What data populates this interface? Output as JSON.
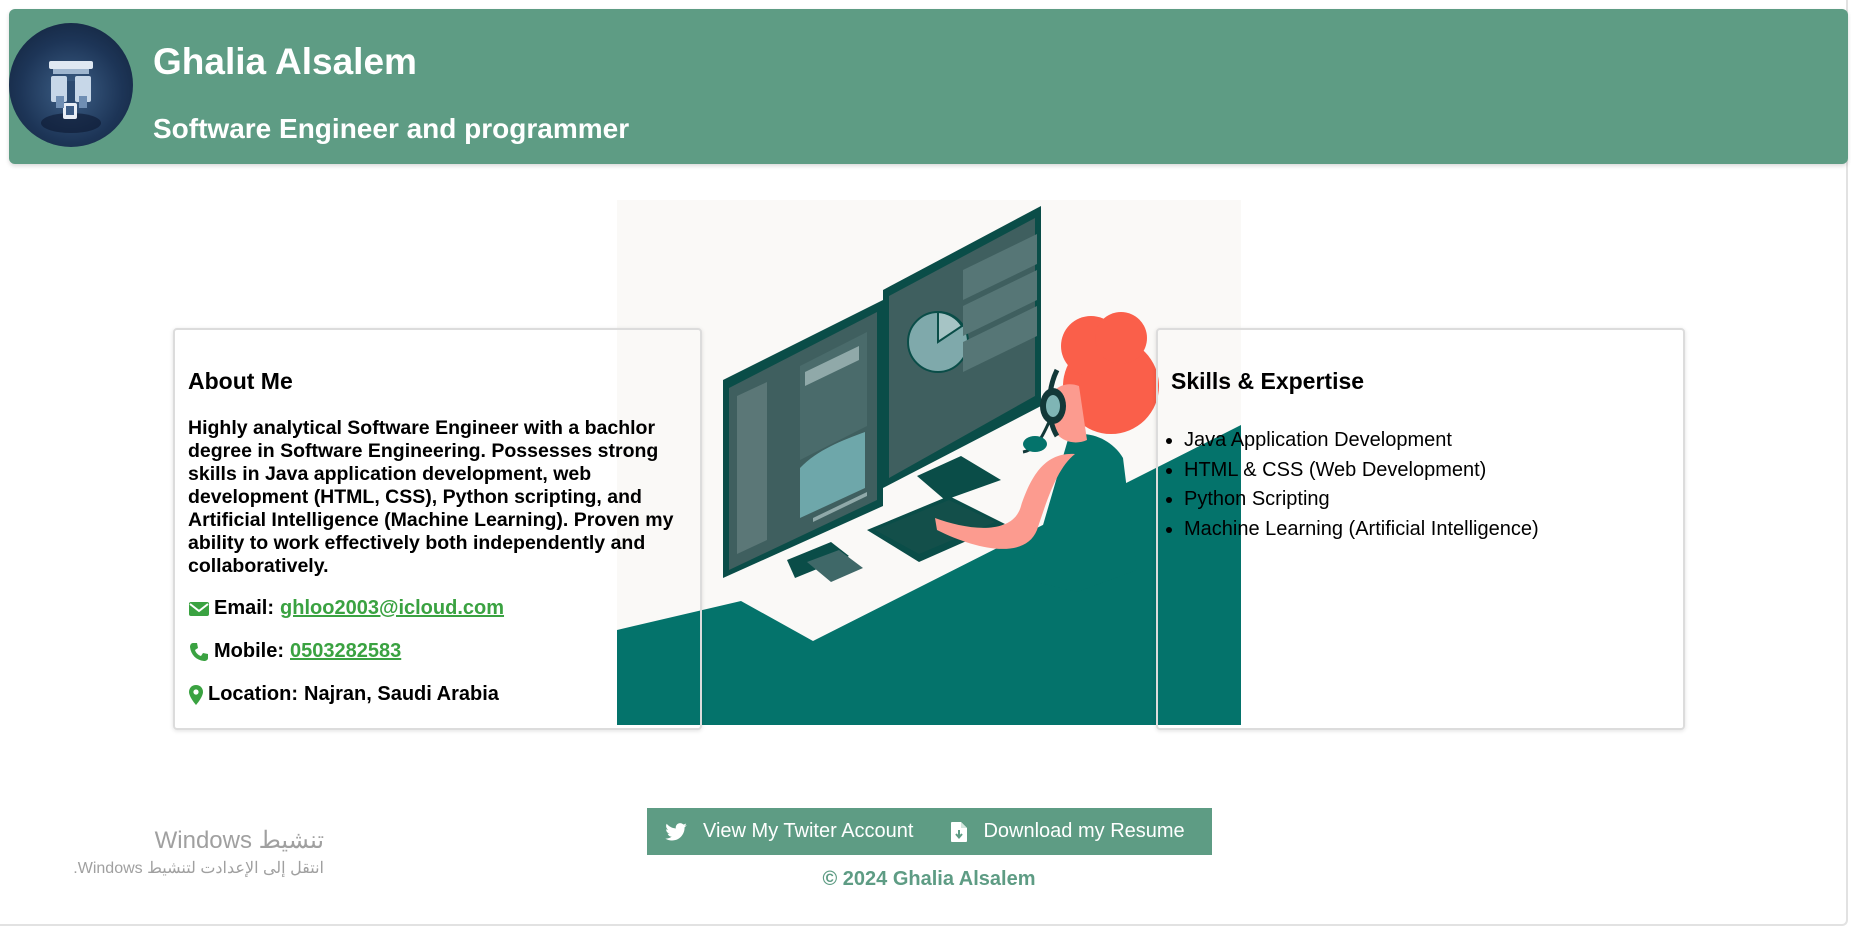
{
  "header": {
    "name": "Ghalia Alsalem",
    "subtitle": "Software Engineer and programmer"
  },
  "about": {
    "heading": "About Me",
    "description": "Highly analytical Software Engineer with a bachlor degree in Software Engineering. Possesses strong skills in Java application development, web development (HTML, CSS), Python scripting, and Artificial Intelligence (Machine Learning). Proven my ability to work effectively both independently and collaboratively.",
    "email_label": "Email:",
    "email_value": "ghloo2003@icloud.com",
    "mobile_label": "Mobile:",
    "mobile_value": "0503282583",
    "location_label": "Location:",
    "location_value": "Najran, Saudi Arabia"
  },
  "skills": {
    "heading": "Skills & Expertise",
    "items": [
      "Java Application Development",
      "HTML & CSS (Web Development)",
      "Python Scripting",
      "Machine Learning (Artificial Intelligence)"
    ]
  },
  "actions": {
    "twitter_label": "View My Twiter Account",
    "resume_label": "Download my Resume"
  },
  "footer": {
    "copyright": "© 2024 Ghalia Alsalem"
  },
  "watermark": {
    "title": "تنشيط Windows",
    "subtitle": "انتقل إلى الإعدادت لتنشيط Windows."
  },
  "colors": {
    "brand": "#5e9c84",
    "link": "#3aa241",
    "illustration_teal": "#04736b",
    "illustration_hair": "#fa5f4a"
  }
}
